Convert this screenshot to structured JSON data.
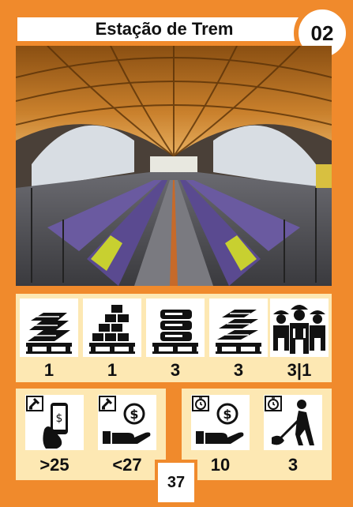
{
  "card": {
    "title": "Estação de Trem",
    "number": "02",
    "bottom_number": "37",
    "colors": {
      "border": "#f08a2c",
      "panel": "#fde8b3",
      "icon_bg": "#ffffff"
    }
  },
  "resources": [
    {
      "icon": "lumber-pallet-icon",
      "value": "1"
    },
    {
      "icon": "bricks-pallet-icon",
      "value": "1"
    },
    {
      "icon": "barrels-pallet-icon",
      "value": "3"
    },
    {
      "icon": "steel-beams-pallet-icon",
      "value": "3"
    },
    {
      "icon": "workers-icon",
      "value": "3|1"
    }
  ],
  "actions": [
    {
      "icon": "auction-phone-payment-icon",
      "value": ">25"
    },
    {
      "icon": "auction-hand-coin-icon",
      "value": "<27"
    },
    {
      "icon": "timer-hand-coin-icon",
      "value": "10"
    },
    {
      "icon": "timer-digging-worker-icon",
      "value": "3"
    }
  ]
}
